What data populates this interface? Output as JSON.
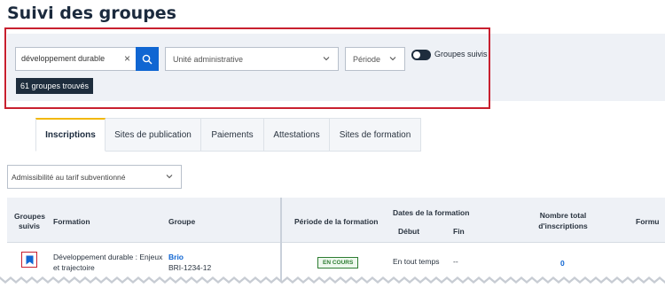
{
  "page": {
    "title": "Suivi des groupes"
  },
  "filters": {
    "search_value": "développement durable",
    "unit_placeholder": "Unité administrative",
    "period_placeholder": "Période",
    "followed_toggle_label": "Groupes suivis",
    "result_count": "61 groupes trouvés"
  },
  "tabs": [
    {
      "label": "Inscriptions",
      "active": true
    },
    {
      "label": "Sites de publication",
      "active": false
    },
    {
      "label": "Paiements",
      "active": false
    },
    {
      "label": "Attestations",
      "active": false
    },
    {
      "label": "Sites de formation",
      "active": false
    }
  ],
  "eligibility_filter": "Admissibilité au tarif subventionné",
  "table": {
    "headers": {
      "followed_line1": "Groupes",
      "followed_line2": "suivis",
      "formation": "Formation",
      "group": "Groupe",
      "period": "Période de la formation",
      "dates": "Dates de la formation",
      "start": "Début",
      "end": "Fin",
      "total_line1": "Nombre total",
      "total_line2": "d'inscriptions",
      "truncated": "Formu"
    },
    "rows": [
      {
        "formation_line1": "Développement durable : Enjeux",
        "formation_line2": "et trajectoire",
        "group_name": "Brio",
        "group_code": "BRI-1234-12",
        "status": "EN COURS",
        "start": "En tout temps",
        "end": "--",
        "total": "0"
      }
    ]
  },
  "colors": {
    "primary": "#1066d2",
    "dark": "#1e2d3d",
    "highlight": "#c8202f",
    "tab_accent": "#f2b807",
    "status_green": "#2e7d32",
    "panel_bg": "#eef1f6"
  },
  "icons": {
    "search": "search-icon",
    "clear": "close-icon",
    "dropdown": "chevron-down-icon",
    "bookmark": "bookmark-icon"
  }
}
